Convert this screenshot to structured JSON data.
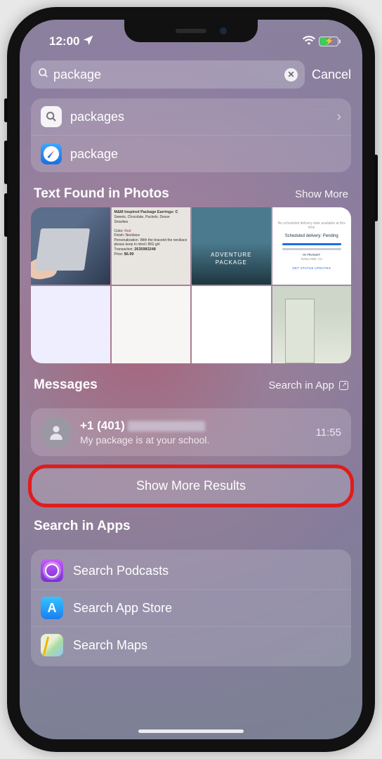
{
  "status": {
    "time": "12:00"
  },
  "search": {
    "value": "package",
    "cancel": "Cancel"
  },
  "suggestions": [
    {
      "icon": "search",
      "label": "packages",
      "chevron": true
    },
    {
      "icon": "safari",
      "label": "package",
      "chevron": false
    }
  ],
  "photos_section": {
    "title": "Text Found in Photos",
    "more": "Show More",
    "tiles": {
      "p2": {
        "title": "M&M Inspired Package Earrings: C",
        "line1": "Sweets, Chocolate, Packets, Desse",
        "line2": "Smarties",
        "color_label": "Color:",
        "color_value": "Red",
        "finish_label": "Finish:",
        "finish_value": "Necklace",
        "pers": "Personalization. With the bracelet the necklace please keep in mind i BIG girl",
        "trans_label": "Transaction:",
        "trans_value": "2635983248",
        "price_label": "Price:",
        "price_value": "$6.99"
      },
      "p3": {
        "line1": "ADVENTURE",
        "line2": "PACKAGE"
      },
      "p4": {
        "head": "No scheduled delivery date available at this time",
        "status": "Scheduled delivery: Pending",
        "transit": "IN TRANSIT",
        "loc": "OAKLAND, CA",
        "btn": "GET STATUS UPDATES"
      }
    }
  },
  "messages_section": {
    "title": "Messages",
    "link": "Search in App",
    "item": {
      "name_prefix": "+1 (401)",
      "preview": "My package is at your school.",
      "time": "11:55"
    }
  },
  "show_more": "Show More Results",
  "apps_section": {
    "title": "Search in Apps",
    "items": [
      {
        "icon": "pod",
        "label": "Search Podcasts"
      },
      {
        "icon": "store",
        "label": "Search App Store"
      },
      {
        "icon": "maps",
        "label": "Search Maps"
      }
    ]
  }
}
